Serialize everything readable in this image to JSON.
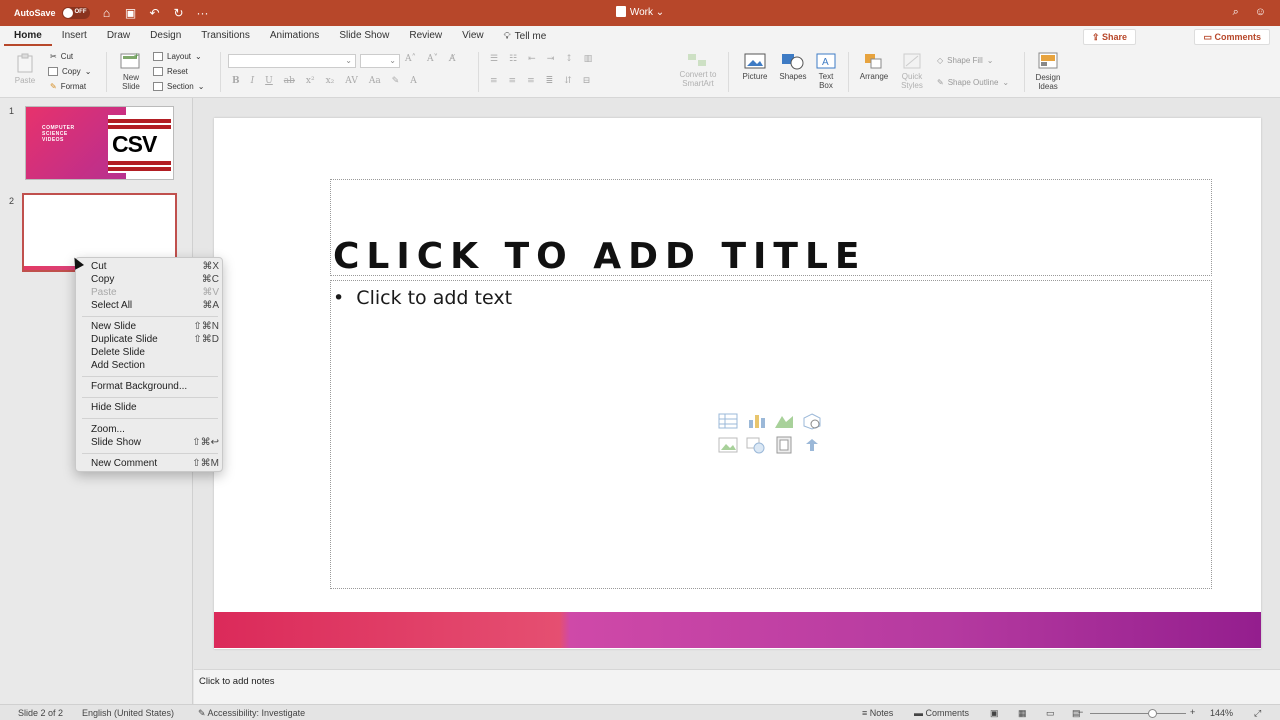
{
  "titlebar": {
    "autosave_label": "AutoSave",
    "autosave_state": "OFF",
    "doc_title": "Work"
  },
  "tabs": [
    "Home",
    "Insert",
    "Draw",
    "Design",
    "Transitions",
    "Animations",
    "Slide Show",
    "Review",
    "View"
  ],
  "tell_me": "Tell me",
  "share_label": "Share",
  "comments_label": "Comments",
  "ribbon": {
    "paste": "Paste",
    "cut": "Cut",
    "copy": "Copy",
    "format": "Format",
    "new_slide": "New Slide",
    "layout": "Layout",
    "reset": "Reset",
    "section": "Section",
    "convert_smartart": "Convert to SmartArt",
    "picture": "Picture",
    "shapes": "Shapes",
    "text_box": "Text Box",
    "arrange": "Arrange",
    "quick_styles": "Quick Styles",
    "shape_fill": "Shape Fill",
    "shape_outline": "Shape Outline",
    "design_ideas": "Design Ideas"
  },
  "thumb1": {
    "number": "1",
    "text": "COMPUTER SCIENCE VIDEOS",
    "logo": "CSV"
  },
  "thumb2": {
    "number": "2"
  },
  "context_menu": [
    {
      "label": "Cut",
      "shortcut": "⌘X",
      "enabled": true
    },
    {
      "label": "Copy",
      "shortcut": "⌘C",
      "enabled": true
    },
    {
      "label": "Paste",
      "shortcut": "⌘V",
      "enabled": false
    },
    {
      "label": "Select All",
      "shortcut": "⌘A",
      "enabled": true
    },
    {
      "label": "New Slide",
      "shortcut": "⇧⌘N",
      "enabled": true
    },
    {
      "label": "Duplicate Slide",
      "shortcut": "⇧⌘D",
      "enabled": true
    },
    {
      "label": "Delete Slide",
      "shortcut": "",
      "enabled": true
    },
    {
      "label": "Add Section",
      "shortcut": "",
      "enabled": true
    },
    {
      "label": "Format Background...",
      "shortcut": "",
      "enabled": true
    },
    {
      "label": "Hide Slide",
      "shortcut": "",
      "enabled": true
    },
    {
      "label": "Zoom...",
      "shortcut": "",
      "enabled": true
    },
    {
      "label": "Slide Show",
      "shortcut": "⇧⌘↩",
      "enabled": true
    },
    {
      "label": "New Comment",
      "shortcut": "⇧⌘M",
      "enabled": true
    }
  ],
  "slide": {
    "title_placeholder": "CLICK TO ADD TITLE",
    "body_placeholder": "Click to add text"
  },
  "notes_placeholder": "Click to add notes",
  "status": {
    "slide_count": "Slide 2 of 2",
    "language": "English (United States)",
    "accessibility": "Accessibility: Investigate",
    "notes": "Notes",
    "comments": "Comments",
    "zoom": "144%"
  },
  "colors": {
    "brand": "#b7472a",
    "accent_pink": "#db2a5a",
    "accent_purple": "#941e8e"
  }
}
